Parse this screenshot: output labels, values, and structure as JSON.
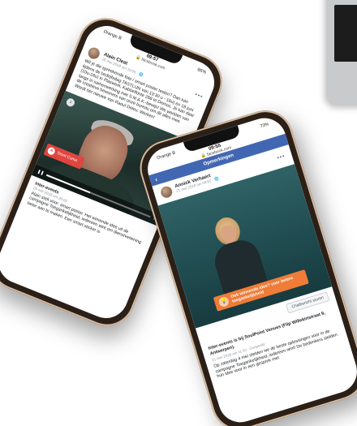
{
  "phone1": {
    "carrier": "Orange B",
    "time": "09:57",
    "url": "facebook.com",
    "battery": "86%",
    "post": {
      "author": "Alain Cleat",
      "meta": "25 mei 2018 om 10:00 · ",
      "text": "Wil je die spreekende foto / smart poster testen? Dan kan tijdens de bedrijfsdag TASTLIJN van 10:30 u - 16u) en 18 juni (10u-16u) in Plaswerk, Kabbelfonte 268 te Demos. Je kan daar langs in samenwerking met S.M.A.K.-bewijs! We werkten van de creatieve bewoners van onze bureau om dit alles mee. Wordt het nieuwe van Raoul Deleu. Werken!"
    },
    "video": {
      "cta_label": "Stoot Cuma",
      "cta_icon": "A",
      "progress": 0.42
    },
    "page": {
      "name": "Inter-events",
      "date": "25 mei 2018 om 20:05 · ",
      "text": "Alain stelt voor: smart poster. Het wimende idee uit de campagne Toegankelijkheid, iedereen wint om dienstverlening beter aan te maken. Een smart sticker is"
    }
  },
  "phone2": {
    "carrier": "Orange B",
    "time": "09:55",
    "url": "facebook.com",
    "battery": "73%",
    "header_title": "Opmerkingen",
    "post": {
      "author": "Annick Verhaert",
      "meta": "21 mei 2018 om 08:52 · "
    },
    "photo": {
      "banner_text": "Ook winnende idee? voor betere toegankelijkheid"
    },
    "chat_label": "Chatbericht sturen",
    "caption": "Inter-events is bij SoulPoint Venues (Flip Willekirtstraat 9, Antwerpen).",
    "caption_meta": "21 mei 2018 om 11:10 · Gespeeld · ",
    "body": "Op zaterdag 4 mei stelden we de beste oplossingen voor in de campagne Toegankelijkheid, iedereen wint! De bedenkers stelden hun idee voor in een gesprek met"
  }
}
